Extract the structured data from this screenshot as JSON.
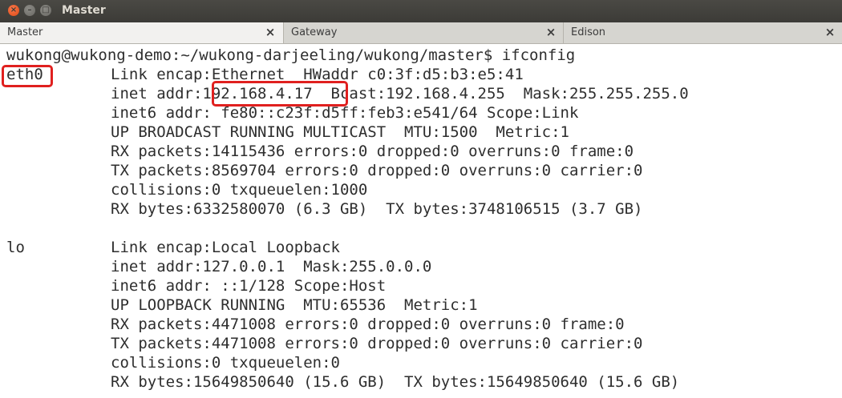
{
  "window": {
    "title": "Master",
    "close_glyph": "×",
    "min_glyph": "–",
    "max_glyph": "□"
  },
  "tabs": [
    {
      "label": "Master",
      "close_glyph": "×",
      "active": true
    },
    {
      "label": "Gateway",
      "close_glyph": "×",
      "active": false
    },
    {
      "label": "Edison",
      "close_glyph": "×",
      "active": false
    }
  ],
  "terminal": {
    "prompt": "wukong@wukong-demo:~/wukong-darjeeling/wukong/master$ ifconfig",
    "interfaces": [
      {
        "name": "eth0",
        "highlighted": true,
        "lines": [
          "Link encap:Ethernet  HWaddr c0:3f:d5:b3:e5:41",
          "inet addr:192.168.4.17  Bcast:192.168.4.255  Mask:255.255.255.0",
          "inet6 addr: fe80::c23f:d5ff:feb3:e541/64 Scope:Link",
          "UP BROADCAST RUNNING MULTICAST  MTU:1500  Metric:1",
          "RX packets:14115436 errors:0 dropped:0 overruns:0 frame:0",
          "TX packets:8569704 errors:0 dropped:0 overruns:0 carrier:0",
          "collisions:0 txqueuelen:1000",
          "RX bytes:6332580070 (6.3 GB)  TX bytes:3748106515 (3.7 GB)"
        ]
      },
      {
        "name": "lo",
        "highlighted": false,
        "lines": [
          "Link encap:Local Loopback",
          "inet addr:127.0.0.1  Mask:255.0.0.0",
          "inet6 addr: ::1/128 Scope:Host",
          "UP LOOPBACK RUNNING  MTU:65536  Metric:1",
          "RX packets:4471008 errors:0 dropped:0 overruns:0 frame:0",
          "TX packets:4471008 errors:0 dropped:0 overruns:0 carrier:0",
          "collisions:0 txqueuelen:0",
          "RX bytes:15649850640 (15.6 GB)  TX bytes:15649850640 (15.6 GB)"
        ]
      }
    ],
    "highlighted_value": "192.168.4.17",
    "colors": {
      "text": "#2e2e2e",
      "background": "#ffffff",
      "highlight_border": "#e0201f"
    }
  }
}
